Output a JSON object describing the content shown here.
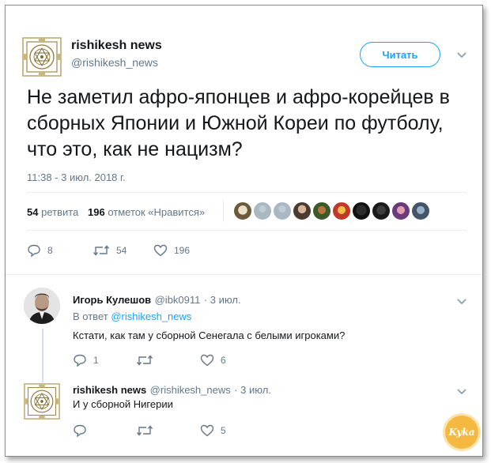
{
  "tweet": {
    "author_name": "rishikesh news",
    "author_handle": "@rishikesh_news",
    "follow_label": "Читать",
    "text": "Не заметил афро-японцев и афро-корейцев в сборных Японии и Южной Кореи по футболу, что это, как не нацизм?",
    "timestamp": "11:38 - 3 июл. 2018 г.",
    "retweets_count": "54",
    "retweets_label": "ретвита",
    "likes_count": "196",
    "likes_label": "отметок «Нравится»",
    "actions": {
      "replies": "8",
      "retweets": "54",
      "likes": "196"
    }
  },
  "replies": [
    {
      "author_name": "Игорь Кулешов",
      "author_handle": "@ibk0911",
      "date": "· 3 июл.",
      "reply_to_prefix": "В ответ",
      "reply_to_handle": "@rishikesh_news",
      "text": "Кстати, как там у сборной Сенегала с белыми игроками?",
      "actions": {
        "replies": "1",
        "retweets": "",
        "likes": "6"
      }
    },
    {
      "author_name": "rishikesh news",
      "author_handle": "@rishikesh_news",
      "date": "· 3 июл.",
      "text": "И у сборной Нигерии",
      "actions": {
        "replies": "",
        "retweets": "",
        "likes": "5"
      }
    }
  ],
  "watermark": {
    "text": "Kyka"
  },
  "colors": {
    "accent": "#1da1f2",
    "text": "#14171a",
    "muted": "#657786",
    "divider": "#e6ecf0"
  },
  "icons": [
    "mandala-logo-avatar",
    "chevron-down-icon",
    "reply-icon",
    "retweet-icon",
    "like-icon"
  ]
}
